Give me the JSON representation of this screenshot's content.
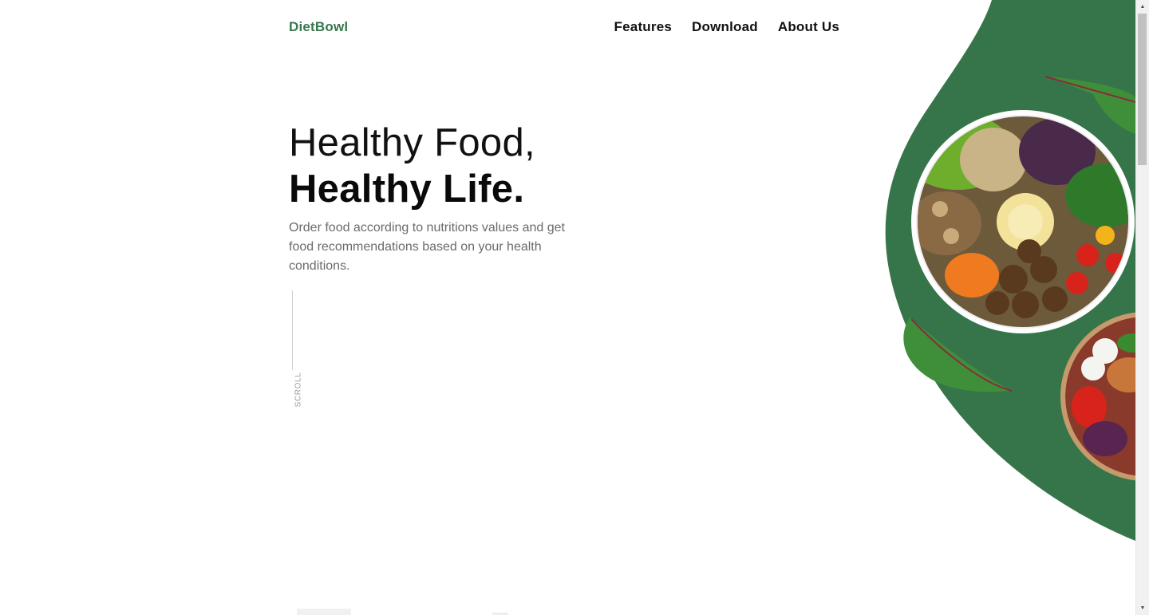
{
  "brand": {
    "name": "DietBowl",
    "color": "#37774c"
  },
  "nav": {
    "items": [
      {
        "label": "Features"
      },
      {
        "label": "Download"
      },
      {
        "label": "About Us"
      }
    ]
  },
  "hero": {
    "title_line1": "Healthy Food,",
    "title_line2": "Healthy Life.",
    "description": "Order food according to nutritions values and get food recommendations based on your health conditions.",
    "scroll_label": "SCROLL"
  },
  "illustration": {
    "icon": "salad-bowl-illustration",
    "accent_color": "#36754a"
  },
  "scrollbar": {
    "up_icon": "▲",
    "down_icon": "▼"
  }
}
